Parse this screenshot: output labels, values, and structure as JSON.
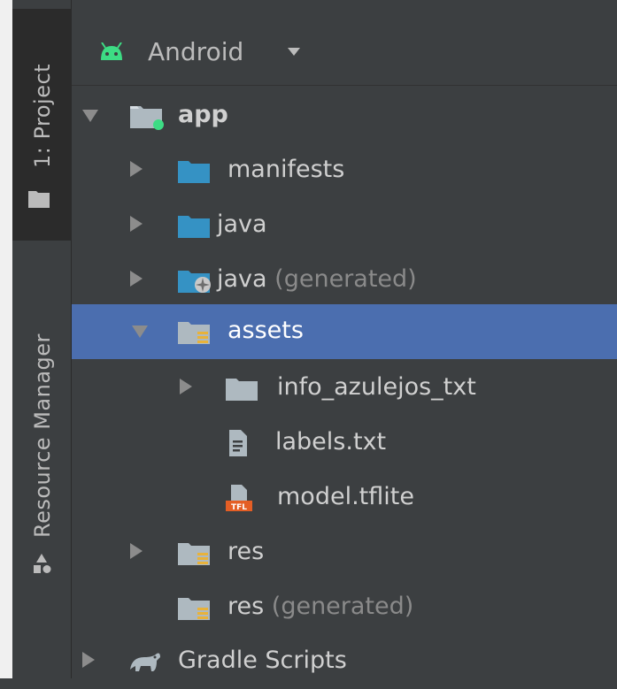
{
  "tool_window": {
    "project_tab_label": "1: Project",
    "resource_manager_label": "Resource Manager"
  },
  "header": {
    "view_selector": "Android"
  },
  "tree": {
    "app": "app",
    "manifests": "manifests",
    "java": "java",
    "java_generated_name": "java",
    "java_generated_suffix": "(generated)",
    "assets": "assets",
    "info_folder": "info_azulejos_txt",
    "labels_file": "labels.txt",
    "model_file": "model.tflite",
    "res": "res",
    "res_generated_name": "res",
    "res_generated_suffix": "(generated)",
    "gradle_scripts": "Gradle Scripts"
  },
  "icon_badges": {
    "tflite_badge": "TFL"
  },
  "colors": {
    "selection": "#4b6eaf",
    "folder_blue": "#3592c4",
    "folder_gray": "#aeb9c0",
    "android_green": "#3ddc84",
    "resource_yellow": "#e8b23a",
    "tflite_orange": "#e45e25"
  }
}
